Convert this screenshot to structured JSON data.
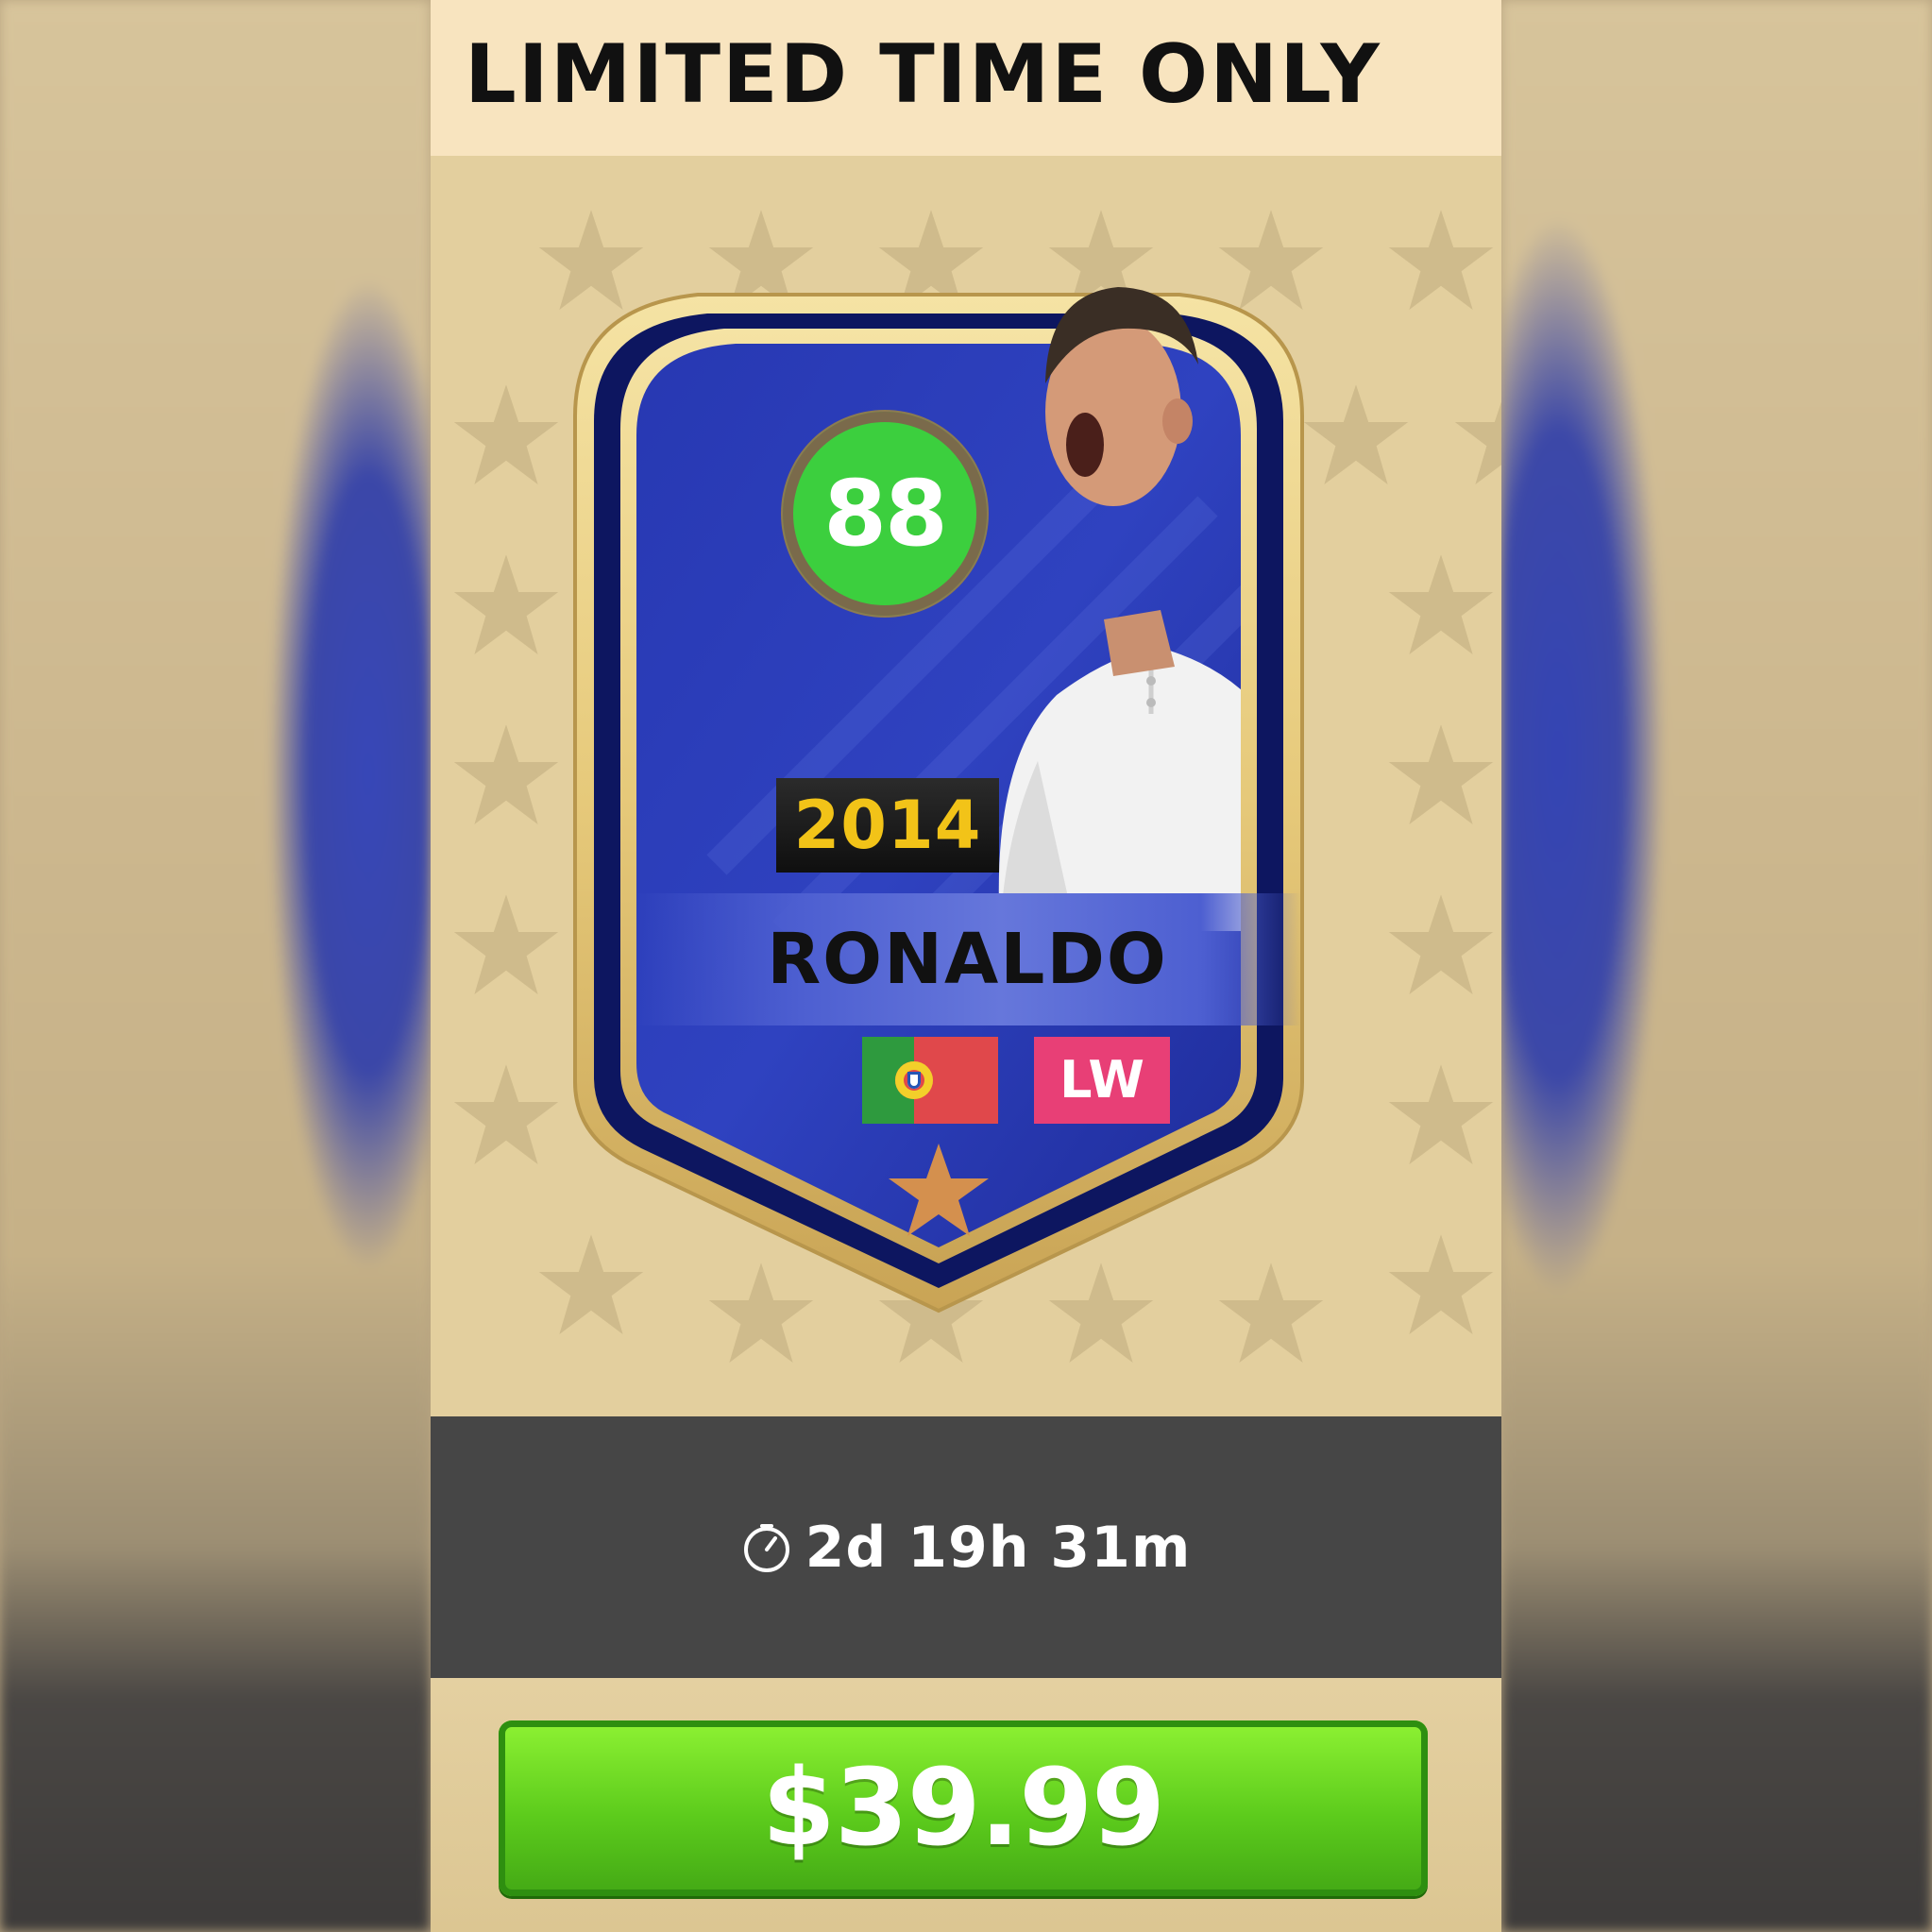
{
  "offer": {
    "banner_title": "LIMITED TIME ONLY",
    "timer_icon": "stopwatch-icon",
    "time_remaining": "2d 19h 31m",
    "price_label": "$39.99"
  },
  "player_card": {
    "rating": "88",
    "year": "2014",
    "name": "RONALDO",
    "nationality_flag": "portugal-flag-icon",
    "position": "LW",
    "card_star_icon": "star-icon"
  },
  "colors": {
    "card_blue": "#2f3fb8",
    "card_gold_frame": "#e9cf82",
    "rating_green": "#3ccf3e",
    "year_yellow": "#f2c318",
    "position_pink": "#e83f76",
    "timer_bar": "#464646",
    "buy_button_green": "#5ccb1c",
    "header_bg": "#f8e4bf"
  }
}
